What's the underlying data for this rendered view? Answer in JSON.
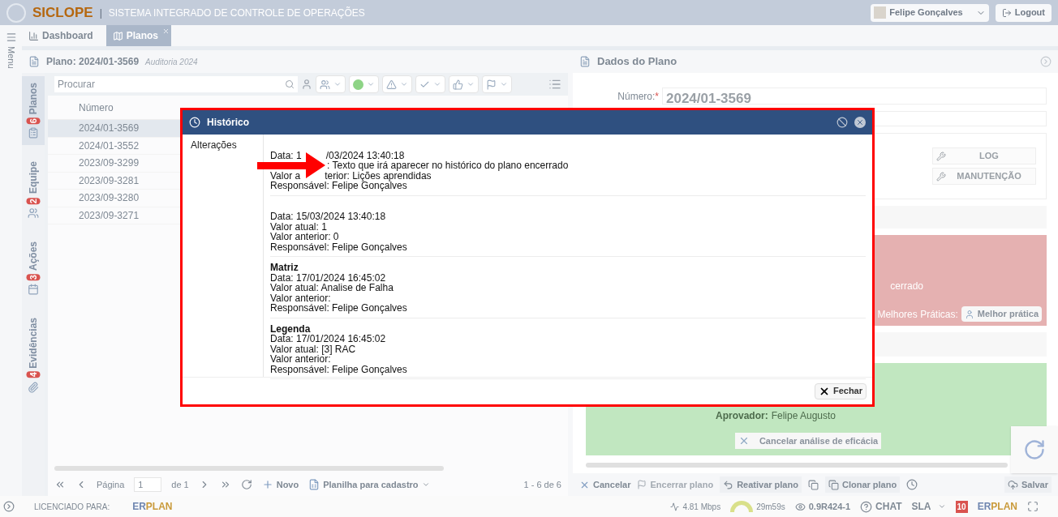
{
  "header": {
    "logo": "SICLOPE",
    "separator": "|",
    "title": "SISTEMA INTEGRADO DE CONTROLE DE OPERAÇÕES",
    "user": "Felipe Gonçalves",
    "logout": "Logout"
  },
  "menu_label": "Menu",
  "tabs": [
    {
      "label": "Dashboard",
      "selected": false,
      "closable": false
    },
    {
      "label": "Planos",
      "selected": true,
      "closable": true
    }
  ],
  "left_panel": {
    "title": "Plano: 2024/01-3569",
    "subtitle": "Auditoria 2024",
    "side_tabs": [
      {
        "label": "Planos",
        "count": "6",
        "selected": true
      },
      {
        "label": "Equipe",
        "count": "2",
        "selected": false
      },
      {
        "label": "Ações",
        "count": "3",
        "selected": false
      },
      {
        "label": "Evidências",
        "count": "4",
        "selected": false
      }
    ],
    "search": {
      "placeholder": "Procurar"
    },
    "table": {
      "columns": [
        "Número"
      ],
      "rows": [
        {
          "number": "2024/01-3569",
          "selected": true
        },
        {
          "number": "2024/01-3552",
          "selected": false
        },
        {
          "number": "2023/09-3299",
          "selected": false
        },
        {
          "number": "2023/09-3281",
          "selected": false
        },
        {
          "number": "2023/09-3280",
          "selected": false
        },
        {
          "number": "2023/09-3271",
          "selected": false
        }
      ]
    },
    "pagination": {
      "page_label": "Página",
      "page": "1",
      "of": "de 1",
      "new": "Novo",
      "sheet": "Planilha para cadastro",
      "range": "1 - 6 de 6"
    }
  },
  "right_panel": {
    "title": "Dados do Plano",
    "number_label": "Número:",
    "required_mark": "*",
    "number": "2024/01-3569",
    "buttons": [
      "LOG",
      "MANUTENÇÃO"
    ],
    "red_box": {
      "text": "cerrado",
      "best_label": "Melhores Práticas:",
      "best_button": "Melhor prática"
    },
    "green_box": {
      "approver_label": "Aprovador:",
      "approver": "Felipe Augusto",
      "cancel_button": "Cancelar análise de eficácia"
    },
    "actions": [
      "Cancelar",
      "Encerrar plano",
      "Reativar plano",
      "Clonar plano"
    ],
    "save": "Salvar"
  },
  "status_bar": {
    "licensed": "LICENCIADO PARA:",
    "brand_a": "ER",
    "brand_b": "PLAN",
    "speed": "4.81 Mbps",
    "timer": "29m59s",
    "version": "0.9R424-1",
    "chat": "CHAT",
    "sla": "SLA",
    "notifications": "10",
    "brand2_a": "ER",
    "brand2_b": "PLAN"
  },
  "dialog": {
    "title": "Histórico",
    "section": "Alterações",
    "close": "Fechar",
    "entries": [
      {
        "lines": [
          [
            "Data: 1",
            "/03/2024 13:40:18"
          ],
          [
            ": Texto que irá aparecer no histórico do plano encerrado"
          ],
          [
            "Valor a",
            "terior: Lições aprendidas"
          ],
          [
            "Responsável: Felipe Gonçalves"
          ]
        ]
      },
      {
        "lines": [
          [
            "Data: 15/03/2024 13:40:18"
          ],
          [
            "Valor atual: 1"
          ],
          [
            "Valor anterior: 0"
          ],
          [
            "Responsável: Felipe Gonçalves"
          ]
        ]
      },
      {
        "heading": "Matriz",
        "lines": [
          [
            "Data: 17/01/2024 16:45:02"
          ],
          [
            "Valor atual: Analise de Falha"
          ],
          [
            "Valor anterior:"
          ],
          [
            "Responsável: Felipe Gonçalves"
          ]
        ]
      },
      {
        "heading": "Legenda",
        "lines": [
          [
            "Data: 17/01/2024 16:45:02"
          ],
          [
            "Valor atual: [3] RAC"
          ],
          [
            "Valor anterior:"
          ],
          [
            "Responsável: Felipe Gonçalves"
          ]
        ]
      }
    ]
  }
}
